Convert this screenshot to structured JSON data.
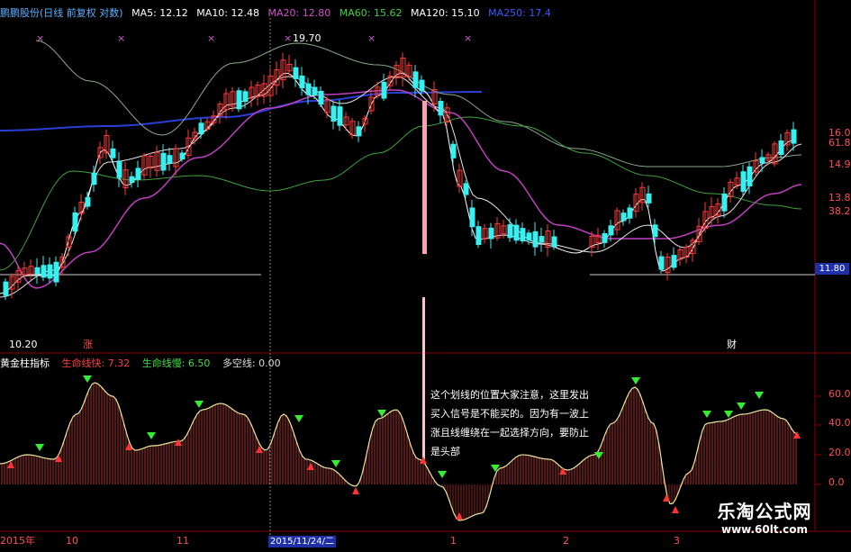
{
  "header": {
    "stock_name": "鹏鹏股份(日线 前复权 对数)",
    "ma5": "MA5: 12.12",
    "ma10": "MA10: 12.48",
    "ma20": "MA20: 12.80",
    "ma60": "MA60: 15.62",
    "ma120": "MA120: 15.10",
    "ma250": "MA250: 17.4"
  },
  "price_panel": {
    "high_label": "19.70",
    "low_label": "10.20",
    "current_price_tag": "11.80",
    "marker_zhang": "涨",
    "marker_cai": "财",
    "right_axis": [
      "16.0",
      "61.8",
      "14.9",
      "13.8",
      "38.2",
      "11.80"
    ]
  },
  "indicator_panel": {
    "title": "黄金柱指标",
    "fast_label": "生命线快: 7.32",
    "slow_label": "生命线慢: 6.50",
    "longshort_label": "多空线: 0.00",
    "right_axis": [
      "60.0",
      "40.0",
      "20.0",
      "0.0"
    ]
  },
  "x_axis": {
    "labels": [
      "2015年",
      "10",
      "11",
      "2015/11/24/二",
      "1",
      "2",
      "3"
    ]
  },
  "annotation": {
    "lines": [
      "这个划线的位置大家注意，这里发出",
      "买入信号是不能买的。因为有一波上",
      "涨且线缠绕在一起选择方向，要防止",
      "是头部"
    ]
  },
  "watermark": {
    "title": "乐淘公式网",
    "url": "www.60lt.com"
  },
  "colors": {
    "up": "#ff3b3b",
    "down": "#38f0f0",
    "ma5": "#ffffff",
    "ma10": "#e6e6e6",
    "ma20": "#c040c0",
    "ma60": "#3ea33e",
    "ma120": "#8aa88a",
    "ma250": "#2a3fd6",
    "grid": "#8b0000"
  }
}
